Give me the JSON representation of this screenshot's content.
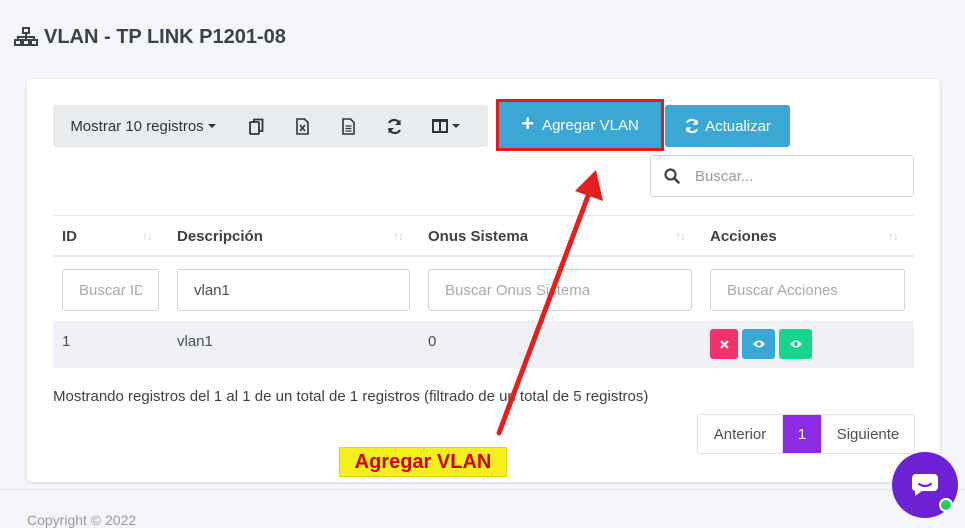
{
  "page": {
    "title": "VLAN - TP LINK P1201-08"
  },
  "toolbar": {
    "show_records_label": "Mostrar 10 registros",
    "copy_icon": "copy-icon",
    "excel_icon": "excel-icon",
    "pdf_icon": "document-icon",
    "reload_icon": "refresh-icon",
    "columns_icon": "columns-icon",
    "add_button_label": "Agregar VLAN",
    "refresh_button_label": "Actualizar"
  },
  "search": {
    "placeholder": "Buscar..."
  },
  "table": {
    "columns": [
      {
        "label": "ID"
      },
      {
        "label": "Descripción"
      },
      {
        "label": "Onus Sistema"
      },
      {
        "label": "Acciones"
      }
    ],
    "filters": {
      "id_placeholder": "Buscar ID",
      "desc_value": "vlan1",
      "desc_placeholder": "Buscar Descripción",
      "onus_placeholder": "Buscar Onus Sistema",
      "actions_placeholder": "Buscar Acciones"
    },
    "rows": [
      {
        "id": "1",
        "descripcion": "vlan1",
        "onus": "0"
      }
    ]
  },
  "info": "Mostrando registros del 1 al 1 de un total de 1 registros (filtrado de un total de 5 registros)",
  "pagination": {
    "prev": "Anterior",
    "current": "1",
    "next": "Siguiente"
  },
  "footer": {
    "copyright": "Copyright © 2022"
  },
  "annotation": {
    "label": "Agregar VLAN"
  },
  "colors": {
    "primary": "#3aa7d4",
    "highlight_border": "#e01b1b",
    "delete": "#f0336e",
    "view": "#3aa7d4",
    "view_alt": "#17d68c",
    "page_active": "#8a2be2",
    "chat": "#6c22d4"
  }
}
